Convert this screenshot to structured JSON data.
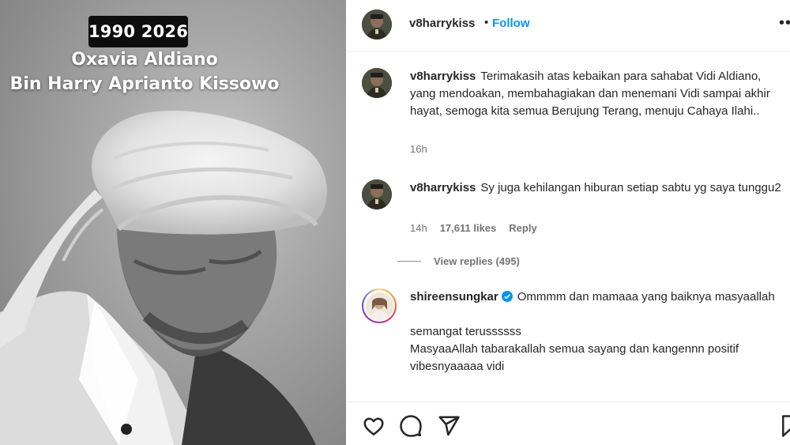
{
  "media": {
    "years": "1990 2026",
    "name_line1": "Oxavia Aldiano",
    "name_line2": "Bin Harry Aprianto Kissowo"
  },
  "header": {
    "username": "v8harrykiss",
    "separator": "•",
    "follow_label": "Follow",
    "more_icon": "more-horizontal-icon"
  },
  "comments": [
    {
      "username": "v8harrykiss",
      "text": "Terimakasih atas kebaikan para sahabat Vidi Aldiano, yang mendoakan, membahagiakan dan menemani Vidi sampai akhir hayat, semoga kita semua Berujung Terang, menuju Cahaya Ilahi..",
      "time": "16h"
    },
    {
      "username": "v8harrykiss",
      "text": "Sy juga kehilangan hiburan setiap sabtu yg saya tunggu2",
      "time": "14h",
      "likes": "17,611 likes",
      "reply_label": "Reply",
      "view_replies": "View replies (495)"
    },
    {
      "username": "shireensungkar",
      "verified": true,
      "text": "Ommmm dan mamaaa yang baiknya masyaallah",
      "text2": "semangat terussssss",
      "text3": "MasyaaAllah tabarakallah semua sayang dan kangennn positif vibesnyaaaaa vidi"
    }
  ],
  "actions": {
    "icons": [
      "heart-icon",
      "comment-icon",
      "share-icon",
      "bookmark-icon"
    ]
  },
  "colors": {
    "follow": "#0095f6",
    "text": "#262626",
    "muted": "#737373",
    "verified": "#0095f6"
  }
}
